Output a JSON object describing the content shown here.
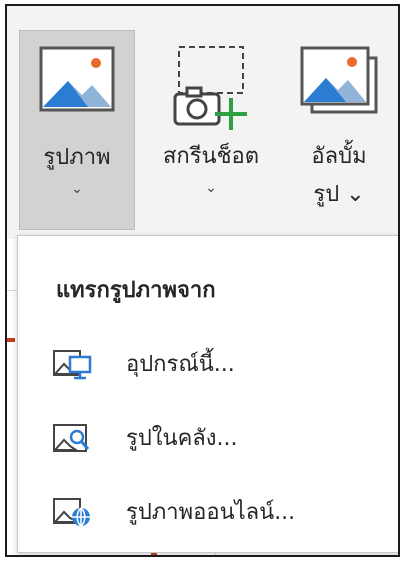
{
  "ribbon": {
    "pictures": {
      "label": "รูปภาพ",
      "chevron": "⌄",
      "icon": "picture-icon"
    },
    "screenshot": {
      "label": "สกรีนช็อต",
      "chevron": "⌄",
      "icon": "screenshot-camera-icon"
    },
    "photo_album": {
      "label_line1": "อัลบั้ม",
      "label_line2": "รูป ⌄",
      "icon": "photo-album-icon"
    }
  },
  "menu": {
    "header": "แทรกรูปภาพจาก",
    "items": [
      {
        "label": "อุปกรณ์นี้...",
        "icon": "this-device-icon"
      },
      {
        "label": "รูปในคลัง...",
        "icon": "stock-images-icon"
      },
      {
        "label": "รูปภาพออนไลน์...",
        "icon": "online-pictures-icon"
      }
    ]
  },
  "colors": {
    "accent": "#c43e1c",
    "icon_blue": "#2b7cd3",
    "icon_orange": "#e86a2c",
    "icon_green": "#2ea043"
  }
}
